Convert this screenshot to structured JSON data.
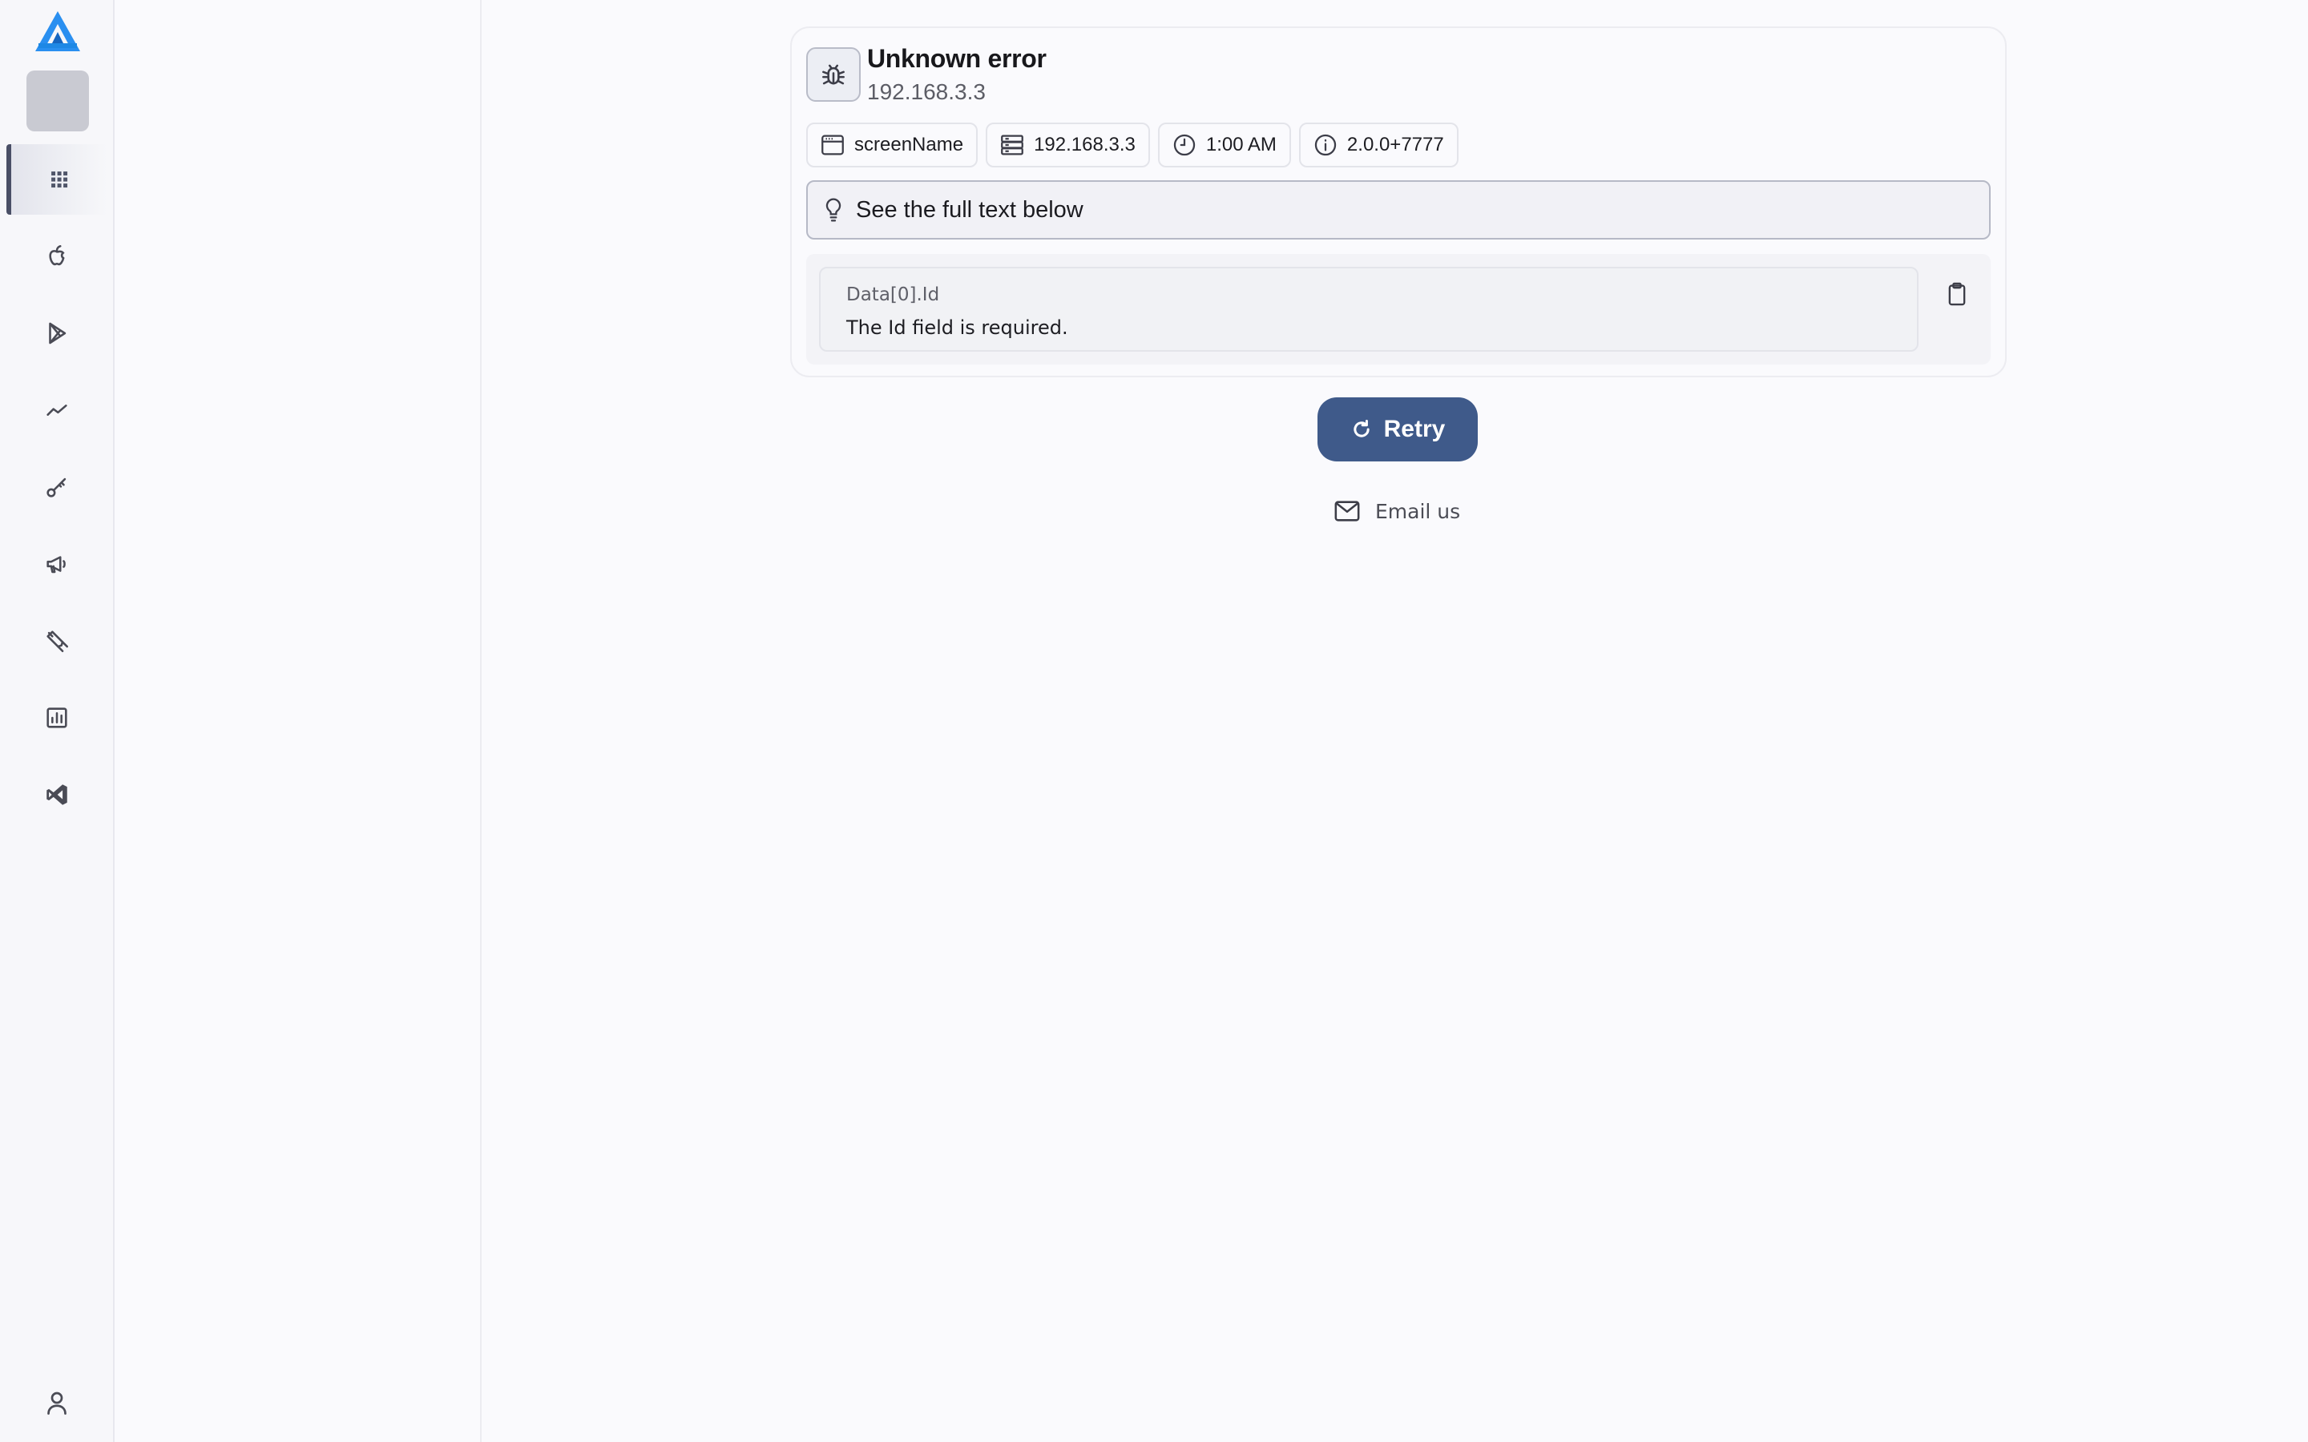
{
  "sidebar": {
    "items": [
      {
        "icon": "apps-grid-icon",
        "active": true
      },
      {
        "icon": "apple-icon",
        "active": false
      },
      {
        "icon": "google-play-icon",
        "active": false
      },
      {
        "icon": "trending-icon",
        "active": false
      },
      {
        "icon": "key-icon",
        "active": false
      },
      {
        "icon": "megaphone-icon",
        "active": false
      },
      {
        "icon": "tools-icon",
        "active": false
      },
      {
        "icon": "bar-chart-icon",
        "active": false
      },
      {
        "icon": "visual-studio-icon",
        "active": false
      }
    ],
    "bottom_icon": "user-icon"
  },
  "error": {
    "title": "Unknown error",
    "subtitle": "192.168.3.3",
    "chips": [
      {
        "icon": "window-icon",
        "label": "screenName"
      },
      {
        "icon": "server-icon",
        "label": "192.168.3.3"
      },
      {
        "icon": "clock-icon",
        "label": "1:00 AM"
      },
      {
        "icon": "info-icon",
        "label": "2.0.0+7777"
      }
    ],
    "hint": "See the full text below",
    "detail": {
      "key": "Data[0].Id",
      "message": "The Id field is required."
    }
  },
  "actions": {
    "retry_label": "Retry",
    "email_label": "Email us"
  },
  "colors": {
    "accent": "#3f5a8a",
    "logo_blue": "#1e88e5"
  }
}
